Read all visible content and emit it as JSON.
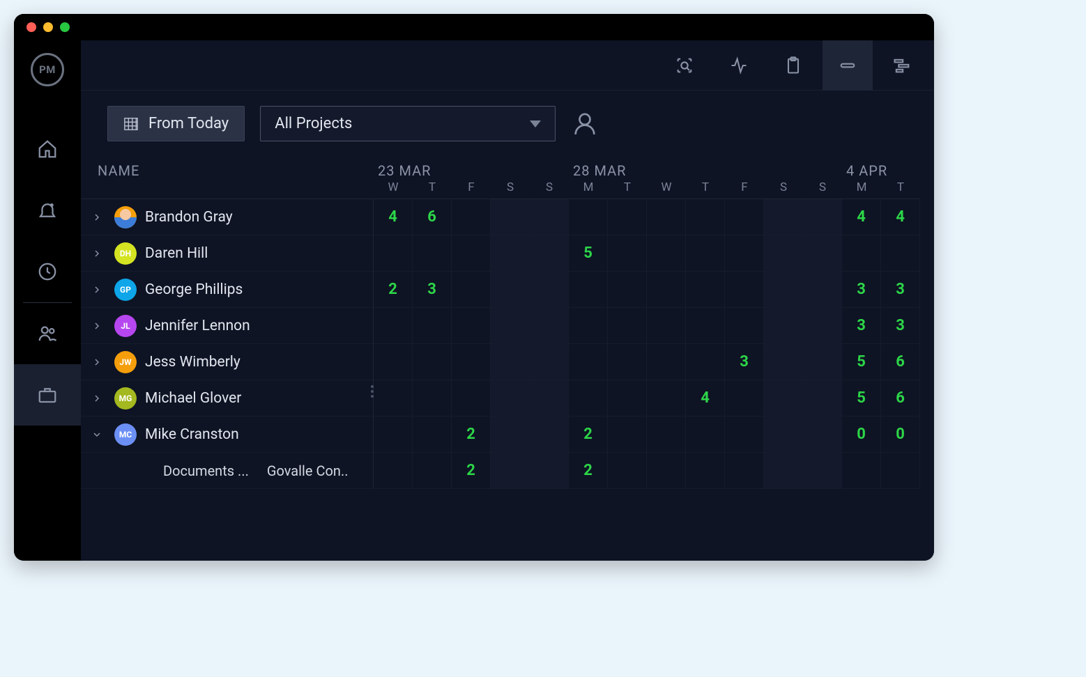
{
  "window": {
    "logo": "PM"
  },
  "toolbar": {
    "from_today_label": "From Today",
    "projects_label": "All Projects"
  },
  "calendar": {
    "name_header": "NAME",
    "spans": [
      "23 MAR",
      "28 MAR",
      "4 APR"
    ],
    "days": [
      "W",
      "T",
      "F",
      "S",
      "S",
      "M",
      "T",
      "W",
      "T",
      "F",
      "S",
      "S",
      "M",
      "T"
    ],
    "weekend_indices": [
      3,
      4,
      10,
      11
    ]
  },
  "people": [
    {
      "name": "Brandon Gray",
      "initials": "",
      "avatar_type": "face",
      "color": "#f59e0b",
      "expanded": false,
      "values": [
        "4",
        "6",
        "",
        "",
        "",
        "",
        "",
        "",
        "",
        "",
        "",
        "",
        "4",
        "4"
      ]
    },
    {
      "name": "Daren Hill",
      "initials": "DH",
      "avatar_type": "initials",
      "color": "#d4e422",
      "expanded": false,
      "values": [
        "",
        "",
        "",
        "",
        "",
        "5",
        "",
        "",
        "",
        "",
        "",
        "",
        "",
        ""
      ]
    },
    {
      "name": "George Phillips",
      "initials": "GP",
      "avatar_type": "initials",
      "color": "#0ea5e9",
      "expanded": false,
      "values": [
        "2",
        "3",
        "",
        "",
        "",
        "",
        "",
        "",
        "",
        "",
        "",
        "",
        "3",
        "3"
      ]
    },
    {
      "name": "Jennifer Lennon",
      "initials": "JL",
      "avatar_type": "initials",
      "color": "#b646ef",
      "expanded": false,
      "values": [
        "",
        "",
        "",
        "",
        "",
        "",
        "",
        "",
        "",
        "",
        "",
        "",
        "3",
        "3"
      ]
    },
    {
      "name": "Jess Wimberly",
      "initials": "JW",
      "avatar_type": "initials",
      "color": "#f59e0b",
      "expanded": false,
      "values": [
        "",
        "",
        "",
        "",
        "",
        "",
        "",
        "",
        "",
        "3",
        "",
        "",
        "5",
        "6"
      ]
    },
    {
      "name": "Michael Glover",
      "initials": "MG",
      "avatar_type": "initials",
      "color": "#a4b81f",
      "expanded": false,
      "values": [
        "",
        "",
        "",
        "",
        "",
        "",
        "",
        "",
        "4",
        "",
        "",
        "",
        "5",
        "6"
      ]
    },
    {
      "name": "Mike Cranston",
      "initials": "MC",
      "avatar_type": "initials",
      "color": "#6b8ff5",
      "expanded": true,
      "values": [
        "",
        "",
        "2",
        "",
        "",
        "2",
        "",
        "",
        "",
        "",
        "",
        "",
        "0",
        "0"
      ],
      "children": [
        {
          "task": "Documents ...",
          "project": "Govalle Con..",
          "values": [
            "",
            "",
            "2",
            "",
            "",
            "2",
            "",
            "",
            "",
            "",
            "",
            "",
            "",
            ""
          ]
        }
      ]
    }
  ]
}
